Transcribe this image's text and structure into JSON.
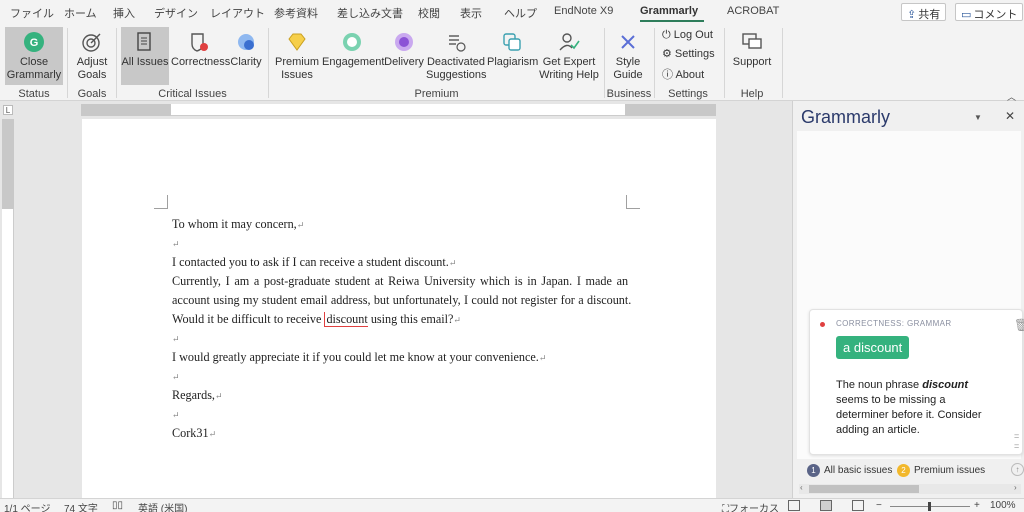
{
  "tabs": [
    "ファイル",
    "ホーム",
    "挿入",
    "デザイン",
    "レイアウト",
    "参考資料",
    "差し込み文書",
    "校閲",
    "表示",
    "ヘルプ",
    "EndNote X9",
    "Grammarly",
    "ACROBAT"
  ],
  "active_tab": "Grammarly",
  "share_label": "共有",
  "comment_label": "コメント",
  "ribbon": {
    "close_grammarly": "Close\nGrammarly",
    "adjust_goals": "Adjust\nGoals",
    "all_issues": "All Issues",
    "correctness": "Correctness",
    "clarity": "Clarity",
    "premium_issues": "Premium\nIssues",
    "engagement": "Engagement",
    "delivery": "Delivery",
    "deactivated": "Deactivated\nSuggestions",
    "plagiarism": "Plagiarism",
    "expert": "Get Expert\nWriting Help",
    "style_guide": "Style\nGuide",
    "log_out": "Log Out",
    "settings": "Settings",
    "about": "About",
    "support": "Support",
    "groups": {
      "status": "Status",
      "goals": "Goals",
      "critical": "Critical Issues",
      "premium": "Premium",
      "business": "Business",
      "settings": "Settings",
      "help": "Help"
    }
  },
  "document": {
    "lines": [
      "To whom it may concern,",
      "",
      "I contacted you to ask if I can receive a student discount.",
      "Currently, I am a post-graduate student at Reiwa University which is in Japan. I made an",
      "account using my student email address, but unfortunately, I could not register for a discount.",
      "Would it be difficult to receive",
      "",
      "I would greatly appreciate it if you could let me know at your convenience.",
      "",
      "Regards,",
      "",
      "Cork31"
    ],
    "error_word": "discount",
    "line6_tail": "using this email?"
  },
  "pane": {
    "title": "Grammarly",
    "card": {
      "category": "CORRECTNESS: GRAMMAR",
      "suggestion": "a discount",
      "text_pre": "The noun phrase ",
      "text_em": "discount",
      "text_post": " seems to be missing a determiner before it. Consider adding an article."
    },
    "footer": {
      "basic_count": "1",
      "basic_label": "All basic issues",
      "premium_count": "2",
      "premium_label": "Premium issues"
    }
  },
  "status_bar": {
    "page": "1/1 ページ",
    "words": "74 文字",
    "language": "英語 (米国)",
    "focus": "フォーカス",
    "zoom": "100%"
  },
  "colors": {
    "grammarly_green": "#35b27e",
    "basic_badge": "#5a6487",
    "premium_badge": "#f2b82c",
    "error_red": "#e04040"
  }
}
